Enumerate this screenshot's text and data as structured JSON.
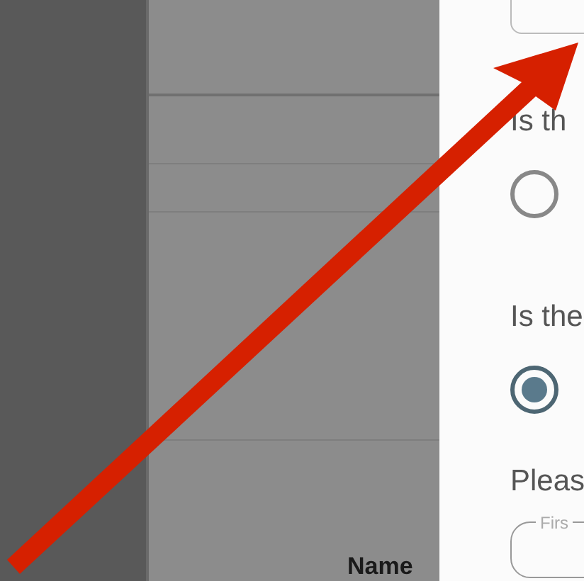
{
  "table": {
    "column_header": "Name"
  },
  "questions": [
    {
      "label": "Is th",
      "selected": false
    },
    {
      "label": "Is the",
      "selected": true
    }
  ],
  "prompt": "Pleas",
  "first_name_field": {
    "label": "Firs"
  }
}
